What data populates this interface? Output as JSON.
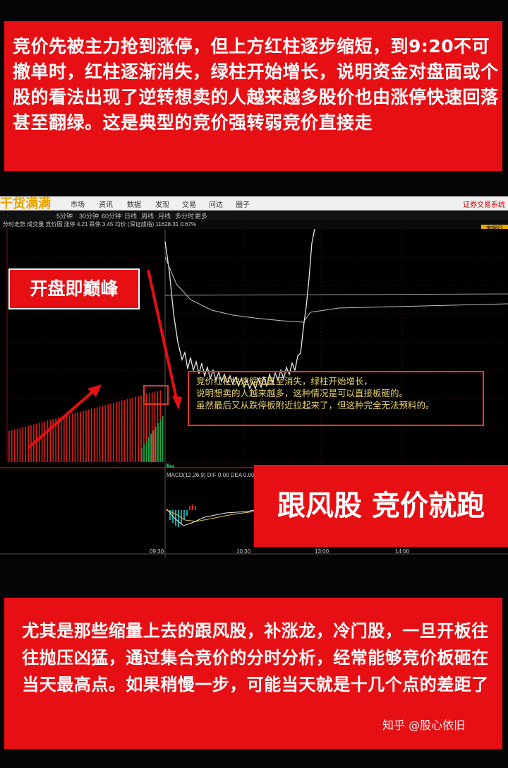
{
  "top_text": "竞价先被主力抢到涨停，但上方红柱逐步缩短，到9:20不可撤单时，红柱逐渐消失，绿柱开始增长，说明资金对盘面或个股的看法出现了逆转想卖的人越来越多股价也由涨停快速回落甚至翻绿。这是典型的竞价强转弱竞价直接走",
  "app": {
    "title": "干货满满",
    "menu": [
      "市场",
      "资讯",
      "数据",
      "发现",
      "交易",
      "问达",
      "圈子"
    ],
    "menu_right": "证券交易系统",
    "periods": [
      "5分钟",
      "30分钟",
      "60分钟",
      "日线",
      "周线",
      "月线",
      "多分时",
      "更多"
    ],
    "info": "分时走势 成交量 竞价图 涨停 4.21 跌停 3.45 均价 (深证成指) 11628.31 0.67%",
    "right_tag": "家银行"
  },
  "labels": {
    "peak": "开盘即巅峰",
    "run": "跟风股 竞价就跑"
  },
  "annotation": {
    "line1": "竞价红柱快速缩短直至消失，绿柱开始增长，",
    "line2": "说明想卖的人越来越多，这种情况是可以直接板砸的。",
    "line3": "虽然最后又从跌停板附近拉起来了，但这种完全无法预料的。"
  },
  "macd_label": "MACD(12,26,9)  DIF 0.00  DEA 0.00",
  "time_axis": [
    "09:30",
    "10:30",
    "13:00",
    "14:00"
  ],
  "bottom_text": "尤其是那些缩量上去的跟风股，补涨龙，冷门股，一旦开板往往抛压凶猛，通过集合竞价的分时分析，经常能够竞价板砸在当天最高点。如果稍慢一步，可能当天就是十几个点的差距了",
  "watermark": "知乎 @股心依旧",
  "colors": {
    "banner_red": "#e60f14",
    "volume_red": "#d8201a",
    "volume_green": "#1aa54a",
    "price_line": "#e8e8e8",
    "avg_line": "#b9c6b0",
    "annotation_text": "#e9d36a"
  }
}
